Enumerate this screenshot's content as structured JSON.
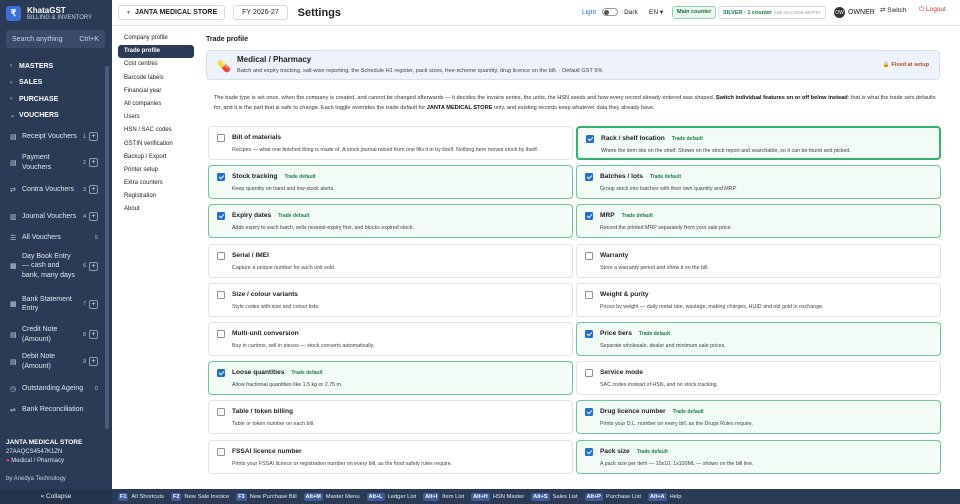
{
  "app": {
    "name": "KhataGST",
    "subtitle": "BILLING & INVENTORY",
    "logo_letter": "₹"
  },
  "search": {
    "placeholder": "Search anything",
    "shortcut": "Ctrl+K"
  },
  "nav": {
    "groups": [
      {
        "label": "MASTERS"
      },
      {
        "label": "SALES"
      },
      {
        "label": "PURCHASE"
      },
      {
        "label": "VOUCHERS"
      }
    ],
    "items": [
      {
        "label": "Receipt Vouchers",
        "count": "1"
      },
      {
        "label": "Payment Vouchers",
        "count": "2"
      },
      {
        "label": "Contra Vouchers",
        "count": "3"
      },
      {
        "label": "Journal Vouchers",
        "count": "4"
      },
      {
        "label": "All Vouchers",
        "count": "5"
      },
      {
        "label": "Day Book Entry — cash and bank, many days",
        "count": "6"
      },
      {
        "label": "Bank Statement Entry",
        "count": "7"
      },
      {
        "label": "Credit Note (Amount)",
        "count": "8"
      },
      {
        "label": "Debit Note (Amount)",
        "count": "9"
      },
      {
        "label": "Outstanding Ageing",
        "count": "0"
      },
      {
        "label": "Bank Reconciliation",
        "count": ""
      }
    ]
  },
  "company_footer": {
    "name": "JANTA MEDICAL STORE",
    "gstin": "27AAQCS4547K1ZN",
    "type": "Medical / Pharmacy"
  },
  "byline": "by Anedya Technology",
  "collapse_label": "« Collapse",
  "topbar": {
    "company": "JANTA MEDICAL STORE",
    "fy": "FY 2026-27",
    "title": "Settings",
    "light": "Light",
    "dark": "Dark",
    "lang": "EN",
    "counter": "Main counter",
    "license_plan": "SILVER · 1 counter",
    "license_key": "AN0-SLV-2026-4E7F57",
    "user": "OWNER",
    "switch": "Switch",
    "logout": "Logout"
  },
  "settings_nav": [
    "Company profile",
    "Trade profile",
    "Cost centres",
    "Barcode labels",
    "Financial year",
    "All companies",
    "Users",
    "HSN / SAC codes",
    "GSTIN verification",
    "Backup / Export",
    "Printer setup",
    "Extra counters",
    "Registration",
    "About"
  ],
  "content": {
    "section_title": "Trade profile",
    "banner_title": "Medical / Pharmacy",
    "banner_desc": "Batch and expiry tracking, salt-wise reporting, the Schedule H1 register, pack sizes, free-scheme quantity, drug licence on the bill. · Default GST 5%",
    "banner_fixed": "Fixed at setup",
    "intro_1": "The trade type is set once, when the company is created, and cannot be changed afterwards — it decides the invoice series, the units, the HSN seeds and how every record already entered was shaped.",
    "intro_bold": "Switch individual features on or off below instead",
    "intro_2": ": that is what the trade sets defaults for, and it is the part that is safe to change. Each toggle overrides the trade default for",
    "intro_company": "JANTA MEDICAL STORE",
    "intro_3": "only, and existing records keep whatever data they already have."
  },
  "badge_text": "Trade default",
  "features_left": [
    {
      "title": "Bill of materials",
      "desc": "Recipes — what one finished thing is made of. A stock journal raised from one fills it in by itself. Nothing here moves stock by itself.",
      "on": false,
      "badge": false
    },
    {
      "title": "Stock tracking",
      "desc": "Keep quantity on hand and low-stock alerts.",
      "on": true,
      "badge": true
    },
    {
      "title": "Expiry dates",
      "desc": "Adds expiry to each batch, sells nearest-expiry first, and blocks expired stock.",
      "on": true,
      "badge": true
    },
    {
      "title": "Serial / IMEI",
      "desc": "Capture a unique number for each unit sold.",
      "on": false,
      "badge": false
    },
    {
      "title": "Size / colour variants",
      "desc": "Style codes with size and colour lists.",
      "on": false,
      "badge": false
    },
    {
      "title": "Multi-unit conversion",
      "desc": "Buy in cartons, sell in pieces — stock converts automatically.",
      "on": false,
      "badge": false
    },
    {
      "title": "Loose quantities",
      "desc": "Allow fractional quantities like 1.5 kg or 2.75 m.",
      "on": true,
      "badge": true
    },
    {
      "title": "Table / token billing",
      "desc": "Table or token number on each bill.",
      "on": false,
      "badge": false
    },
    {
      "title": "FSSAI licence number",
      "desc": "Prints your FSSAI licence or registration number on every bill, as the food safety rules require.",
      "on": false,
      "badge": false
    }
  ],
  "features_right": [
    {
      "title": "Rack / shelf location",
      "desc": "Where the item sits on the shelf. Shown on the stock report and searchable, so it can be found and picked.",
      "on": true,
      "badge": true
    },
    {
      "title": "Batches / lots",
      "desc": "Group stock into batches with their own quantity and MRP.",
      "on": true,
      "badge": true
    },
    {
      "title": "MRP",
      "desc": "Record the printed MRP separately from your sale price.",
      "on": true,
      "badge": true
    },
    {
      "title": "Warranty",
      "desc": "Store a warranty period and show it on the bill.",
      "on": false,
      "badge": false
    },
    {
      "title": "Weight & purity",
      "desc": "Prices by weight — daily metal rate, wastage, making charges, HUID and old gold in exchange.",
      "on": false,
      "badge": false
    },
    {
      "title": "Price tiers",
      "desc": "Separate wholesale, dealer and minimum sale prices.",
      "on": true,
      "badge": true
    },
    {
      "title": "Service mode",
      "desc": "SAC codes instead of HSN, and no stock tracking.",
      "on": false,
      "badge": false
    },
    {
      "title": "Drug licence number",
      "desc": "Prints your D.L. number on every bill, as the Drugs Rules require.",
      "on": true,
      "badge": true
    },
    {
      "title": "Pack size",
      "desc": "A pack size per item — 10x10, 1x100ML — shown on the bill line.",
      "on": true,
      "badge": true
    }
  ],
  "shortcuts": [
    {
      "key": "F1",
      "label": "All Shortcuts"
    },
    {
      "key": "F2",
      "label": "New Sale Invoice"
    },
    {
      "key": "F3",
      "label": "New Purchase Bill"
    },
    {
      "key": "Alt+M",
      "label": "Master Menu"
    },
    {
      "key": "Alt+L",
      "label": "Ledger List"
    },
    {
      "key": "Alt+I",
      "label": "Item List"
    },
    {
      "key": "Alt+H",
      "label": "HSN Master"
    },
    {
      "key": "Alt+S",
      "label": "Sales List"
    },
    {
      "key": "Alt+P",
      "label": "Purchase List"
    },
    {
      "key": "Alt+A",
      "label": "Help"
    }
  ]
}
